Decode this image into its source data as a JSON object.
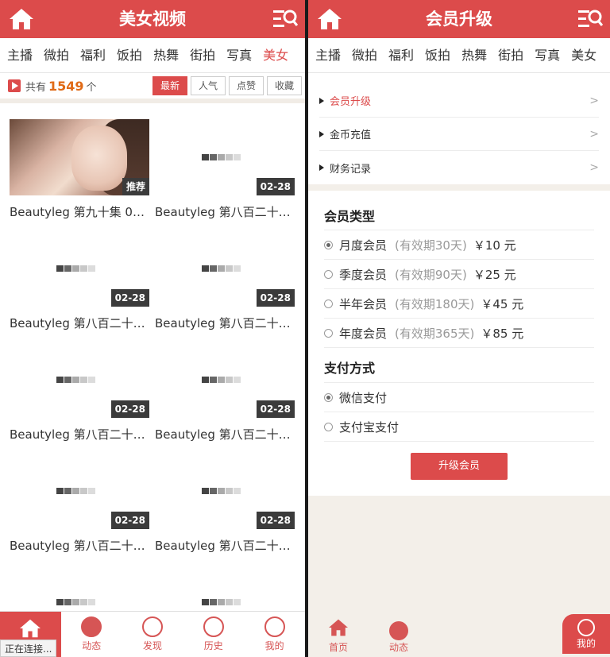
{
  "left": {
    "title": "美女视频",
    "categories": [
      "主播",
      "微拍",
      "福利",
      "饭拍",
      "热舞",
      "街拍",
      "写真",
      "美女"
    ],
    "active_category": "美女",
    "count_prefix": "共有",
    "count_value": "1549",
    "count_suffix": "个",
    "sort_buttons": [
      "最新",
      "人气",
      "点赞",
      "收藏"
    ],
    "videos": [
      {
        "title": "Beautyleg 第九十集 0…",
        "badge": "推荐",
        "photo": true
      },
      {
        "title": "Beautyleg 第八百二十…",
        "badge": "02-28"
      },
      {
        "title": "Beautyleg 第八百二十…",
        "badge": "02-28"
      },
      {
        "title": "Beautyleg 第八百二十…",
        "badge": "02-28"
      },
      {
        "title": "Beautyleg 第八百二十…",
        "badge": "02-28"
      },
      {
        "title": "Beautyleg 第八百二十…",
        "badge": "02-28"
      },
      {
        "title": "Beautyleg 第八百二十…",
        "badge": "02-28"
      },
      {
        "title": "Beautyleg 第八百二十…",
        "badge": "02-28"
      }
    ],
    "tabs": [
      "首页",
      "动态",
      "发现",
      "历史",
      "我的"
    ],
    "status": "正在连接..."
  },
  "right": {
    "title": "会员升级",
    "categories": [
      "主播",
      "微拍",
      "福利",
      "饭拍",
      "热舞",
      "街拍",
      "写真",
      "美女"
    ],
    "menu": [
      "会员升级",
      "金币充值",
      "财务记录"
    ],
    "member_type_heading": "会员类型",
    "member_options": [
      {
        "name": "月度会员",
        "period": "(有效期30天)",
        "price": "￥10 元",
        "checked": true
      },
      {
        "name": "季度会员",
        "period": "(有效期90天)",
        "price": "￥25 元",
        "checked": false
      },
      {
        "name": "半年会员",
        "period": "(有效期180天)",
        "price": "￥45 元",
        "checked": false
      },
      {
        "name": "年度会员",
        "period": "(有效期365天)",
        "price": "￥85 元",
        "checked": false
      }
    ],
    "pay_heading": "支付方式",
    "pay_options": [
      {
        "name": "微信支付",
        "checked": true
      },
      {
        "name": "支付宝支付",
        "checked": false
      }
    ],
    "upgrade_button": "升级会员",
    "tabs": [
      "首页",
      "动态",
      "我的"
    ]
  },
  "colors": {
    "brand": "#dc4b4b",
    "count": "#e06a16"
  }
}
